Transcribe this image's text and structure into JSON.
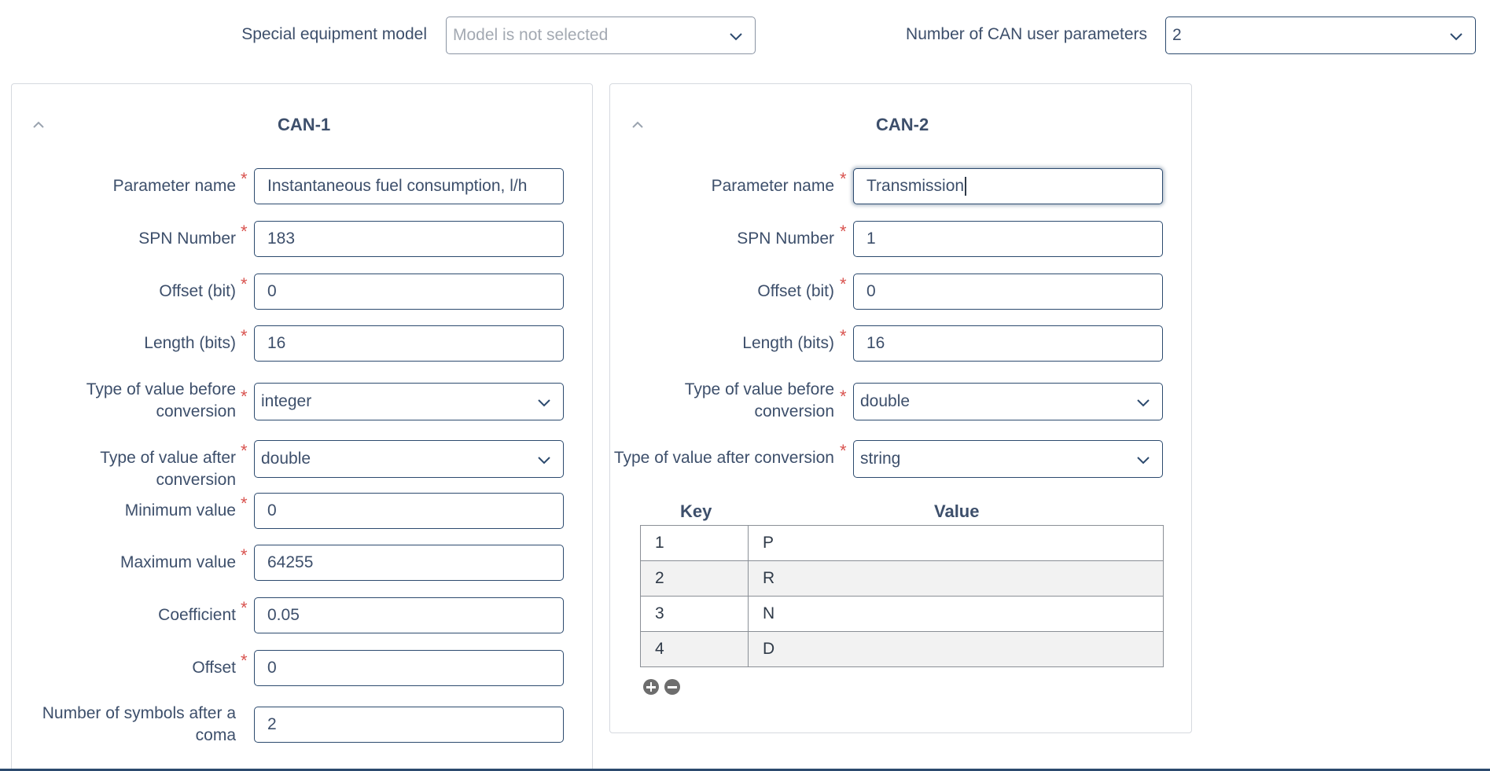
{
  "header": {
    "model_label": "Special equipment model",
    "model_placeholder": "Model is not selected",
    "count_label": "Number of CAN user parameters",
    "count_value": "2"
  },
  "can1": {
    "title": "CAN-1",
    "fields": {
      "param_name_label": "Parameter name",
      "param_name_value": "Instantaneous fuel consumption, l/h",
      "spn_label": "SPN Number",
      "spn_value": "183",
      "offset_bit_label": "Offset (bit)",
      "offset_bit_value": "0",
      "length_label": "Length (bits)",
      "length_value": "16",
      "type_before_label_1": "Type of value before",
      "type_before_label_2": "conversion",
      "type_before_value": "integer",
      "type_after_label": "Type of value after conversion",
      "type_after_value": "double",
      "min_label": "Minimum value",
      "min_value": "0",
      "max_label": "Maximum value",
      "max_value": "64255",
      "coef_label": "Coefficient",
      "coef_value": "0.05",
      "offset_label": "Offset",
      "offset_value": "0",
      "symbols_label_1": "Number of symbols after a",
      "symbols_label_2": "coma",
      "symbols_value": "2"
    }
  },
  "can2": {
    "title": "CAN-2",
    "fields": {
      "param_name_label": "Parameter name",
      "param_name_value": "Transmission",
      "spn_label": "SPN Number",
      "spn_value": "1",
      "offset_bit_label": "Offset (bit)",
      "offset_bit_value": "0",
      "length_label": "Length (bits)",
      "length_value": "16",
      "type_before_label_1": "Type of value before",
      "type_before_label_2": "conversion",
      "type_before_value": "double",
      "type_after_label": "Type of value after conversion",
      "type_after_value": "string"
    },
    "table": {
      "key_header": "Key",
      "value_header": "Value",
      "rows": [
        {
          "key": "1",
          "value": "P"
        },
        {
          "key": "2",
          "value": "R"
        },
        {
          "key": "3",
          "value": "N"
        },
        {
          "key": "4",
          "value": "D"
        }
      ]
    }
  },
  "colors": {
    "accent": "#2c4a6e",
    "required": "#d9534f",
    "text": "#3d4f6b"
  }
}
